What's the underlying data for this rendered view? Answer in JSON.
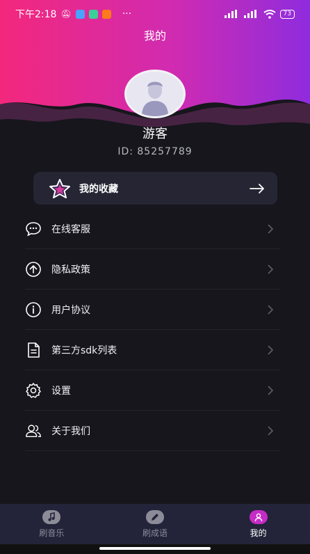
{
  "status_bar": {
    "time": "下午2:18",
    "more": "···",
    "battery": "73"
  },
  "header": {
    "title": "我的"
  },
  "profile": {
    "name": "游客",
    "id_text": "ID:  85257789"
  },
  "favorites": {
    "label": "我的收藏"
  },
  "menu": {
    "items": [
      {
        "label": "在线客服",
        "icon": "chat-bubble-icon"
      },
      {
        "label": "隐私政策",
        "icon": "upload-circle-icon"
      },
      {
        "label": "用户协议",
        "icon": "info-circle-icon"
      },
      {
        "label": "第三方sdk列表",
        "icon": "document-icon"
      },
      {
        "label": "设置",
        "icon": "gear-icon"
      },
      {
        "label": "关于我们",
        "icon": "users-icon"
      }
    ]
  },
  "tabbar": {
    "tabs": [
      {
        "label": "刷音乐",
        "icon": "music-note-icon",
        "active": false
      },
      {
        "label": "刷成语",
        "icon": "pen-icon",
        "active": false
      },
      {
        "label": "我的",
        "icon": "person-icon",
        "active": true
      }
    ]
  },
  "colors": {
    "background": "#16161c",
    "gradient_start": "#ff2e7a",
    "gradient_end": "#8a2be2",
    "accent": "#c52cc6",
    "card": "#252534",
    "tabbar": "#23233a"
  }
}
